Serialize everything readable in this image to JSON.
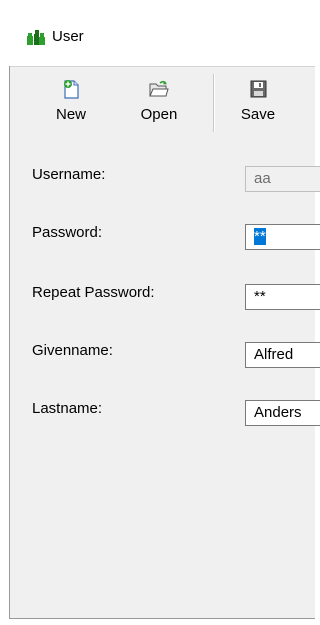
{
  "window": {
    "title": "User",
    "icon": "user-group-icon"
  },
  "toolbar": {
    "new_label": "New",
    "open_label": "Open",
    "save_label": "Save"
  },
  "form": {
    "username_label": "Username:",
    "username_value": "aa",
    "password_label": "Password:",
    "password_value": "**",
    "repeat_password_label": "Repeat Password:",
    "repeat_password_value": "**",
    "givenname_label": "Givenname:",
    "givenname_value": "Alfred",
    "lastname_label": "Lastname:",
    "lastname_value": "Anders"
  },
  "colors": {
    "selection": "#0078d7",
    "client_bg": "#f0f0f0",
    "icon_green": "#2e9e2e",
    "icon_blue": "#3a6fb5"
  }
}
